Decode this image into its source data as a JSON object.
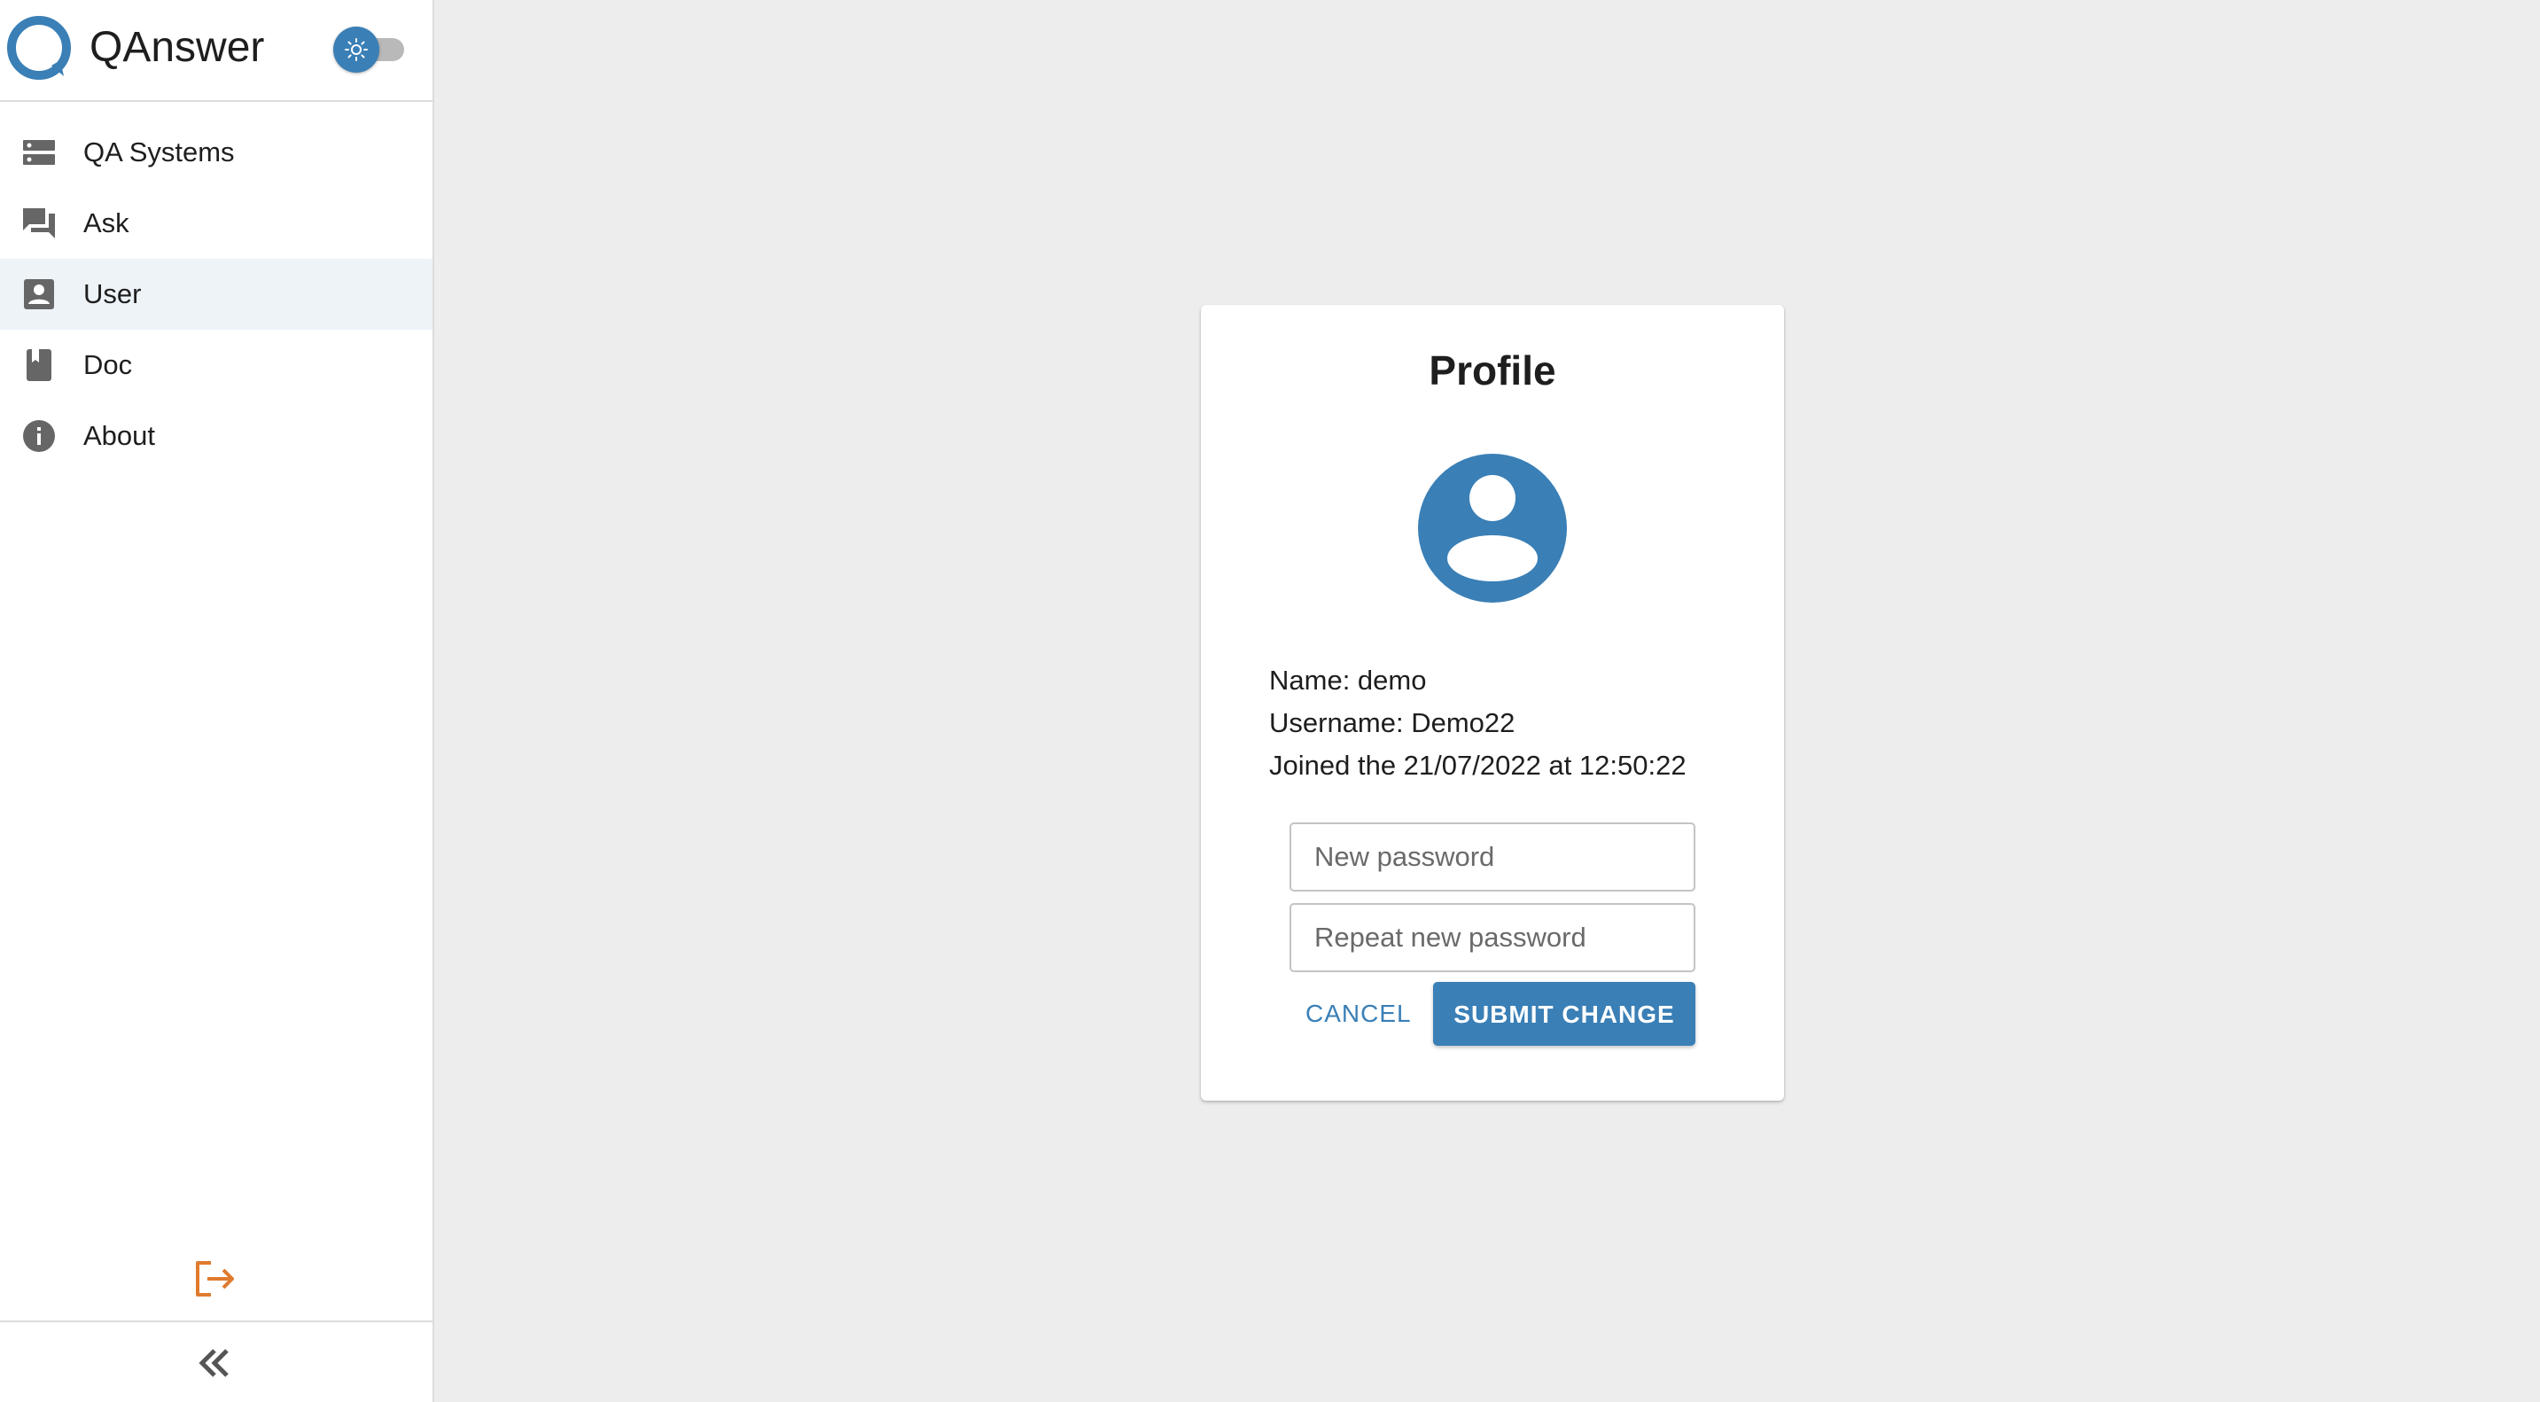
{
  "app": {
    "name": "QAnswer",
    "accent_color": "#3a7fb6",
    "logout_color": "#e07b2e"
  },
  "theme_toggle": {
    "icon": "sun-icon",
    "state": "light"
  },
  "sidebar": {
    "items": [
      {
        "label": "QA Systems",
        "icon": "storage-icon",
        "active": false
      },
      {
        "label": "Ask",
        "icon": "chat-icon",
        "active": false
      },
      {
        "label": "User",
        "icon": "account-box-icon",
        "active": true
      },
      {
        "label": "Doc",
        "icon": "book-icon",
        "active": false
      },
      {
        "label": "About",
        "icon": "info-icon",
        "active": false
      }
    ],
    "logout_icon": "logout-icon",
    "collapse_icon": "double-chevron-left-icon"
  },
  "profile": {
    "title": "Profile",
    "name_line": "Name: demo",
    "username_line": "Username: Demo22",
    "joined_line": "Joined the 21/07/2022 at 12:50:22",
    "new_password_placeholder": "New password",
    "repeat_password_placeholder": "Repeat new password",
    "cancel_label": "CANCEL",
    "submit_label": "SUBMIT CHANGE"
  }
}
